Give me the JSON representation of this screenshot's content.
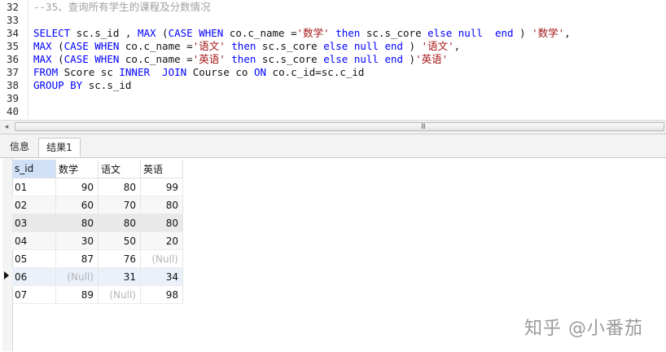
{
  "editor": {
    "lines": [
      {
        "num": "32",
        "segments": [
          {
            "t": "--35、查询所有学生的课程及分数情况",
            "c": "cm"
          }
        ]
      },
      {
        "num": "33",
        "segments": []
      },
      {
        "num": "34",
        "segments": [
          {
            "t": "SELECT",
            "c": "kw"
          },
          {
            "t": " sc.s_id , ",
            "c": "pl"
          },
          {
            "t": "MAX",
            "c": "kw"
          },
          {
            "t": " (",
            "c": "pl"
          },
          {
            "t": "CASE WHEN",
            "c": "kw"
          },
          {
            "t": " co.c_name =",
            "c": "pl"
          },
          {
            "t": "'数学'",
            "c": "str"
          },
          {
            "t": " ",
            "c": "pl"
          },
          {
            "t": "then",
            "c": "kw"
          },
          {
            "t": " sc.s_core ",
            "c": "pl"
          },
          {
            "t": "else null",
            "c": "kw"
          },
          {
            "t": "  ",
            "c": "pl"
          },
          {
            "t": "end",
            "c": "kw"
          },
          {
            "t": " ) ",
            "c": "pl"
          },
          {
            "t": "'数学'",
            "c": "str"
          },
          {
            "t": ",",
            "c": "pl"
          }
        ]
      },
      {
        "num": "35",
        "segments": [
          {
            "t": "MAX",
            "c": "kw"
          },
          {
            "t": " (",
            "c": "pl"
          },
          {
            "t": "CASE WHEN",
            "c": "kw"
          },
          {
            "t": " co.c_name =",
            "c": "pl"
          },
          {
            "t": "'语文'",
            "c": "str"
          },
          {
            "t": " ",
            "c": "pl"
          },
          {
            "t": "then",
            "c": "kw"
          },
          {
            "t": " sc.s_core ",
            "c": "pl"
          },
          {
            "t": "else null end",
            "c": "kw"
          },
          {
            "t": " ) ",
            "c": "pl"
          },
          {
            "t": "'语文'",
            "c": "str"
          },
          {
            "t": ",",
            "c": "pl"
          }
        ]
      },
      {
        "num": "36",
        "segments": [
          {
            "t": "MAX",
            "c": "kw"
          },
          {
            "t": " (",
            "c": "pl"
          },
          {
            "t": "CASE WHEN",
            "c": "kw"
          },
          {
            "t": " co.c_name =",
            "c": "pl"
          },
          {
            "t": "'英语'",
            "c": "str"
          },
          {
            "t": " ",
            "c": "pl"
          },
          {
            "t": "then",
            "c": "kw"
          },
          {
            "t": " sc.s_core ",
            "c": "pl"
          },
          {
            "t": "else null end",
            "c": "kw"
          },
          {
            "t": " )",
            "c": "pl"
          },
          {
            "t": "'英语'",
            "c": "str"
          }
        ]
      },
      {
        "num": "37",
        "segments": [
          {
            "t": "FROM",
            "c": "kw"
          },
          {
            "t": " Score sc ",
            "c": "pl"
          },
          {
            "t": "INNER  JOIN",
            "c": "kw"
          },
          {
            "t": " Course co ",
            "c": "pl"
          },
          {
            "t": "ON",
            "c": "kw"
          },
          {
            "t": " co.c_id=sc.c_id",
            "c": "pl"
          }
        ]
      },
      {
        "num": "38",
        "segments": [
          {
            "t": "GROUP BY",
            "c": "kw"
          },
          {
            "t": " sc.s_id",
            "c": "pl"
          }
        ]
      },
      {
        "num": "39",
        "segments": []
      },
      {
        "num": "40",
        "segments": []
      }
    ]
  },
  "scrollbar": {
    "left_arrow": "◂",
    "grip": "III"
  },
  "tabs": {
    "info": "信息",
    "result": "结果1"
  },
  "grid": {
    "columns": [
      "s_id",
      "数学",
      "语文",
      "英语"
    ],
    "rows": [
      {
        "s_id": "01",
        "math": "90",
        "chinese": "80",
        "english": "99"
      },
      {
        "s_id": "02",
        "math": "60",
        "chinese": "70",
        "english": "80"
      },
      {
        "s_id": "03",
        "math": "80",
        "chinese": "80",
        "english": "80"
      },
      {
        "s_id": "04",
        "math": "30",
        "chinese": "50",
        "english": "20"
      },
      {
        "s_id": "05",
        "math": "87",
        "chinese": "76",
        "english": "(Null)"
      },
      {
        "s_id": "06",
        "math": "(Null)",
        "chinese": "31",
        "english": "34"
      },
      {
        "s_id": "07",
        "math": "89",
        "chinese": "(Null)",
        "english": "98"
      }
    ],
    "current_row": "06"
  },
  "watermark": "知乎 @小番茄",
  "colors": {
    "keyword": "#0000ff",
    "string": "#a31515",
    "comment": "#a0a0a0",
    "header_selected": "#cfe0f7"
  }
}
